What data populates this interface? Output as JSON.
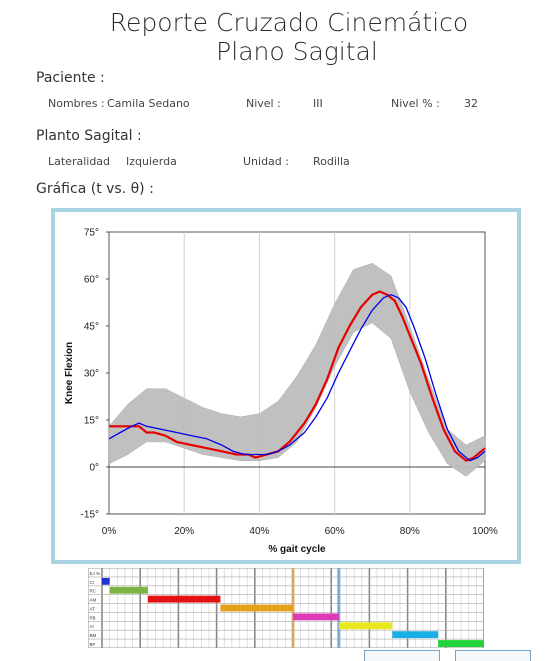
{
  "header": {
    "title_line1": "Reporte Cruzado Cinemático",
    "title_line2": "Plano Sagital"
  },
  "patient": {
    "section_label": "Paciente :",
    "name_label": "Nombres :",
    "name_value": "Camila Sedano",
    "level_label": "Nivel :",
    "level_value": "III",
    "level_pct_label": "Nivel % :",
    "level_pct_value": "32"
  },
  "plane": {
    "section_label": "Planto Sagital :",
    "laterality_label": "Lateralidad",
    "laterality_value": "Izquierda",
    "unit_label": "Unidad :",
    "unit_value": "Rodilla"
  },
  "graph_section": {
    "label": "Gráfica (t vs. θ) :"
  },
  "colors": {
    "frame_border": "#a9d3e0",
    "band": "#bdbdbd",
    "red_series": "#e60000",
    "blue_series": "#0000e6"
  },
  "chart_data": {
    "type": "line",
    "title": "",
    "xlabel": "% gait cycle",
    "ylabel": "Knee Flexion",
    "xlim": [
      0,
      100
    ],
    "ylim": [
      -15,
      75
    ],
    "x_ticks": [
      0,
      20,
      40,
      60,
      80,
      100
    ],
    "x_tick_labels": [
      "0%",
      "20%",
      "40%",
      "60%",
      "80%",
      "100%"
    ],
    "y_ticks": [
      75,
      60,
      45,
      30,
      15,
      0,
      -15
    ],
    "y_tick_labels": [
      "75°",
      "60°",
      "45°",
      "30°",
      "15°",
      "0°",
      "-15°"
    ],
    "grid": "vertical at 20/40/60/80",
    "band": {
      "x": [
        0,
        5,
        10,
        15,
        20,
        25,
        30,
        35,
        40,
        45,
        50,
        55,
        60,
        65,
        70,
        75,
        80,
        85,
        90,
        95,
        100
      ],
      "upper": [
        13,
        20,
        25,
        25,
        22,
        19,
        17,
        16,
        17,
        21,
        29,
        39,
        52,
        63,
        65,
        61,
        45,
        28,
        12,
        7,
        10
      ],
      "lower": [
        1,
        4,
        8,
        8,
        6,
        4,
        3,
        2,
        2,
        3,
        8,
        19,
        32,
        43,
        46,
        41,
        24,
        11,
        1,
        -3,
        2
      ]
    },
    "series": [
      {
        "name": "",
        "color": "#e60000",
        "x": [
          0,
          3,
          6,
          8,
          10,
          12,
          15,
          18,
          22,
          26,
          30,
          34,
          37,
          39,
          42,
          45,
          48,
          52,
          55,
          58,
          61,
          64,
          67,
          70,
          72,
          74,
          76,
          78,
          80,
          83,
          86,
          89,
          92,
          95,
          97,
          100
        ],
        "values": [
          13,
          13,
          13,
          13,
          11,
          11,
          10,
          8,
          7,
          6,
          5,
          4,
          4,
          3,
          4,
          5,
          8,
          14,
          20,
          28,
          38,
          45,
          51,
          55,
          56,
          55,
          53,
          48,
          42,
          33,
          22,
          12,
          5,
          2,
          3,
          6
        ]
      },
      {
        "name": "",
        "color": "#0000e6",
        "x": [
          0,
          3,
          6,
          8,
          10,
          14,
          18,
          22,
          26,
          30,
          33,
          36,
          39,
          42,
          45,
          48,
          52,
          55,
          58,
          61,
          64,
          67,
          70,
          73,
          75,
          77,
          79,
          81,
          84,
          87,
          90,
          93,
          96,
          98,
          100
        ],
        "values": [
          9,
          11,
          13,
          14,
          13,
          12,
          11,
          10,
          9,
          7,
          5,
          4,
          4,
          4,
          5,
          7,
          11,
          16,
          22,
          30,
          37,
          44,
          50,
          54,
          55,
          54,
          51,
          45,
          35,
          23,
          12,
          5,
          2,
          3,
          5
        ]
      }
    ]
  },
  "phase_strip": {
    "row_labels": [
      "EJ %",
      "CI",
      "RC",
      "AM",
      "AT",
      "PB",
      "AI",
      "BM",
      "BF"
    ],
    "bars": [
      {
        "row": 1,
        "start": 0,
        "end": 2,
        "color": "#2233cc"
      },
      {
        "row": 2,
        "start": 2,
        "end": 12,
        "color": "#7db544"
      },
      {
        "row": 3,
        "start": 12,
        "end": 31,
        "color": "#e31111"
      },
      {
        "row": 4,
        "start": 31,
        "end": 50,
        "color": "#e6a01c"
      },
      {
        "row": 5,
        "start": 50,
        "end": 62,
        "color": "#dd3bb5"
      },
      {
        "row": 6,
        "start": 62,
        "end": 76,
        "color": "#e8e81a"
      },
      {
        "row": 7,
        "start": 76,
        "end": 88,
        "color": "#18aee6"
      },
      {
        "row": 8,
        "start": 88,
        "end": 100,
        "color": "#22d23a"
      }
    ],
    "markers": [
      {
        "pos": 50,
        "color": "#e5a868"
      },
      {
        "pos": 62,
        "color": "#6a9ad6"
      }
    ]
  }
}
